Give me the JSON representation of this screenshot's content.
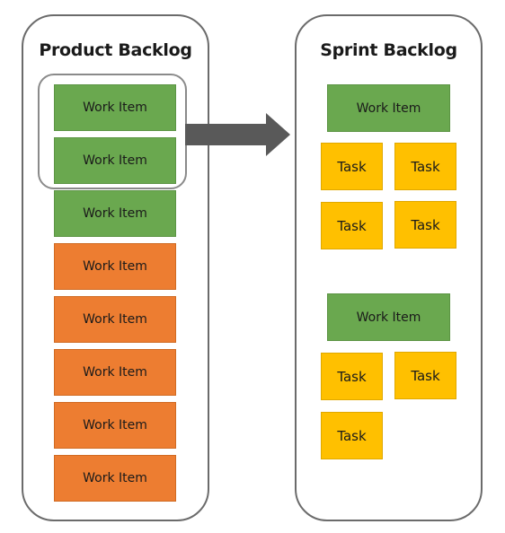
{
  "product_backlog": {
    "title": "Product Backlog",
    "items": [
      {
        "label": "Work Item",
        "status": "selected",
        "color": "#6aa84f"
      },
      {
        "label": "Work Item",
        "status": "selected",
        "color": "#6aa84f"
      },
      {
        "label": "Work Item",
        "status": "ready",
        "color": "#6aa84f"
      },
      {
        "label": "Work Item",
        "status": "backlog",
        "color": "#ed7d31"
      },
      {
        "label": "Work Item",
        "status": "backlog",
        "color": "#ed7d31"
      },
      {
        "label": "Work Item",
        "status": "backlog",
        "color": "#ed7d31"
      },
      {
        "label": "Work Item",
        "status": "backlog",
        "color": "#ed7d31"
      },
      {
        "label": "Work Item",
        "status": "backlog",
        "color": "#ed7d31"
      }
    ]
  },
  "arrow": {
    "icon": "right-arrow-icon",
    "color": "#595959"
  },
  "sprint_backlog": {
    "title": "Sprint Backlog",
    "groups": [
      {
        "work_item": "Work Item",
        "tasks": [
          "Task",
          "Task",
          "Task",
          "Task"
        ]
      },
      {
        "work_item": "Work Item",
        "tasks": [
          "Task",
          "Task",
          "Task"
        ]
      }
    ]
  },
  "colors": {
    "green": "#6aa84f",
    "orange": "#ed7d31",
    "yellow": "#ffc000",
    "border": "#6b6b6b"
  }
}
